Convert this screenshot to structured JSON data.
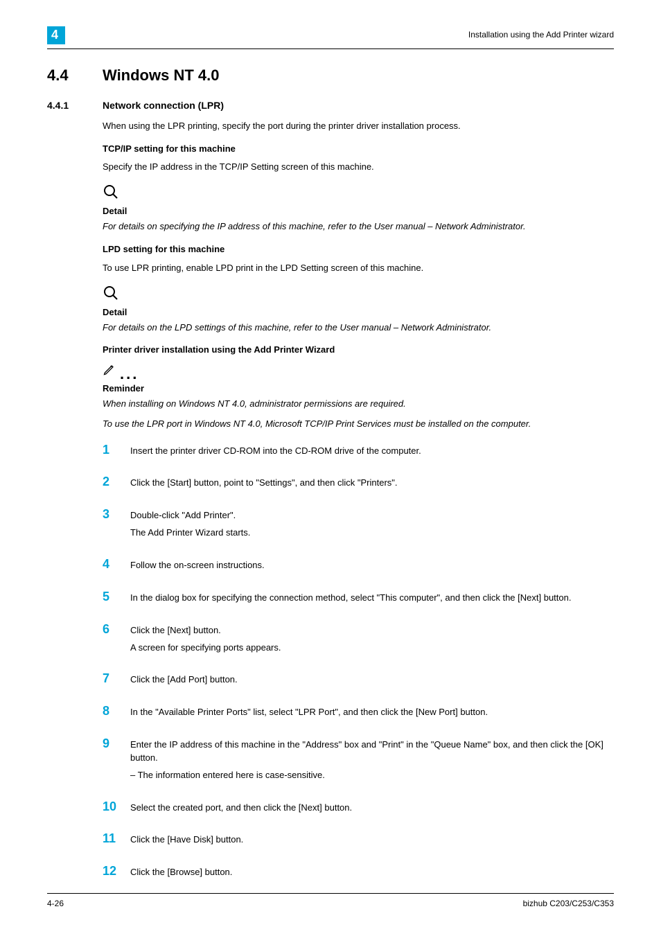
{
  "header": {
    "chapter_number": "4",
    "right_text": "Installation using the Add Printer wizard"
  },
  "h1": {
    "num": "4.4",
    "title": "Windows NT 4.0"
  },
  "h2": {
    "num": "4.4.1",
    "title": "Network connection (LPR)"
  },
  "intro": "When using the LPR printing, specify the port during the printer driver installation process.",
  "sec1": {
    "heading": "TCP/IP setting for this machine",
    "body": "Specify the IP address in the TCP/IP Setting screen of this machine.",
    "detail_label": "Detail",
    "detail_text": "For details on specifying the IP address of this machine, refer to the User manual – Network Administrator."
  },
  "sec2": {
    "heading": "LPD setting for this machine",
    "body": "To use LPR printing, enable LPD print in the LPD Setting screen of this machine.",
    "detail_label": "Detail",
    "detail_text": "For details on the LPD settings of this machine, refer to the User manual – Network Administrator."
  },
  "sec3": {
    "heading": "Printer driver installation using the Add Printer Wizard",
    "reminder_label": "Reminder",
    "reminder_text1": "When installing on Windows NT 4.0, administrator permissions are required.",
    "reminder_text2": "To use the LPR port in Windows NT 4.0, Microsoft TCP/IP Print Services must be installed on the computer."
  },
  "steps": [
    {
      "n": "1",
      "lines": [
        "Insert the printer driver CD-ROM into the CD-ROM drive of the computer."
      ]
    },
    {
      "n": "2",
      "lines": [
        "Click the [Start] button, point to \"Settings\", and then click \"Printers\"."
      ]
    },
    {
      "n": "3",
      "lines": [
        "Double-click \"Add Printer\".",
        "The Add Printer Wizard starts."
      ]
    },
    {
      "n": "4",
      "lines": [
        "Follow the on-screen instructions."
      ]
    },
    {
      "n": "5",
      "lines": [
        "In the dialog box for specifying the connection method, select \"This computer\", and then click the [Next] button."
      ]
    },
    {
      "n": "6",
      "lines": [
        "Click the [Next] button.",
        "A screen for specifying ports appears."
      ]
    },
    {
      "n": "7",
      "lines": [
        "Click the [Add Port] button."
      ]
    },
    {
      "n": "8",
      "lines": [
        "In the \"Available Printer Ports\" list, select \"LPR Port\", and then click the [New Port] button."
      ]
    },
    {
      "n": "9",
      "lines": [
        "Enter the IP address of this machine in the \"Address\" box and \"Print\" in the \"Queue Name\" box, and then click the [OK] button."
      ],
      "sub": "–   The information entered here is case-sensitive."
    },
    {
      "n": "10",
      "lines": [
        "Select the created port, and then click the [Next] button."
      ]
    },
    {
      "n": "11",
      "lines": [
        "Click the [Have Disk] button."
      ]
    },
    {
      "n": "12",
      "lines": [
        "Click the [Browse] button."
      ]
    }
  ],
  "footer": {
    "left": "4-26",
    "right": "bizhub C203/C253/C353"
  }
}
